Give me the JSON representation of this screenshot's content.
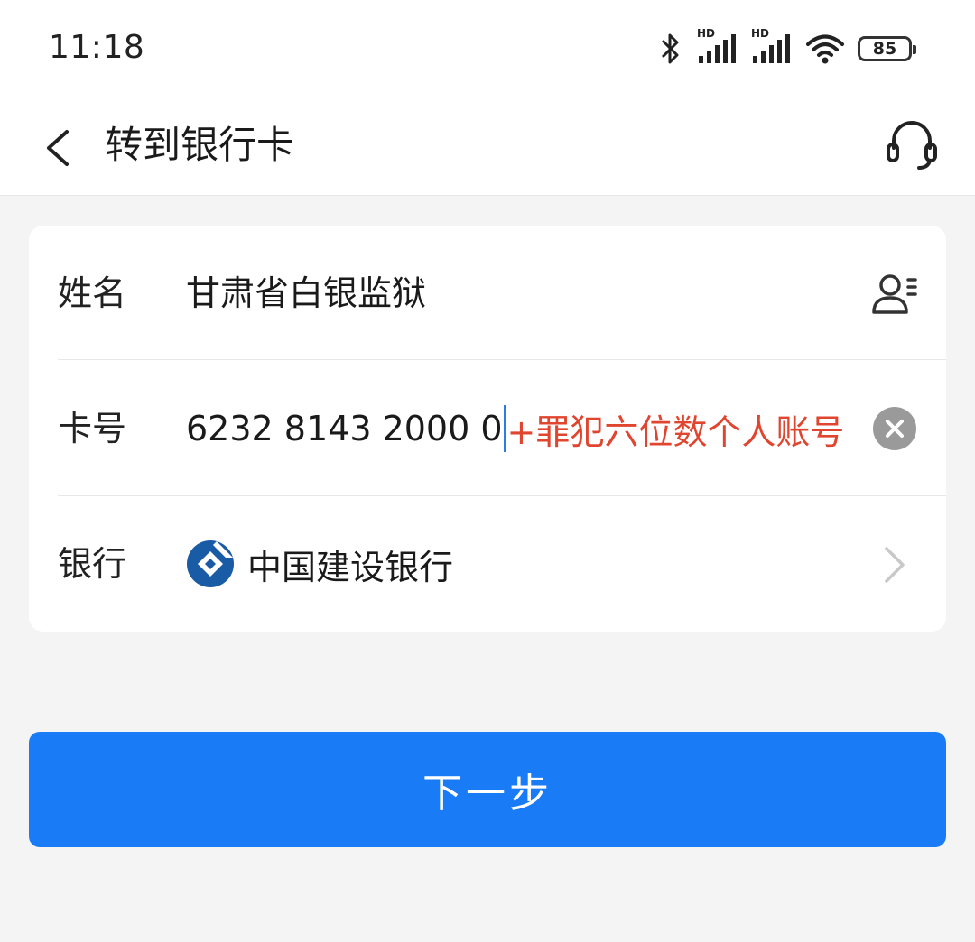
{
  "status_bar": {
    "time": "11:18",
    "battery_level": "85",
    "network_badge_1": "HD",
    "network_badge_2": "HD",
    "icons": [
      "bluetooth-icon",
      "signal-icon",
      "signal-icon",
      "wifi-icon",
      "battery-icon"
    ]
  },
  "header": {
    "title": "转到银行卡",
    "back_icon": "chevron-left-icon",
    "support_icon": "headset-icon"
  },
  "form": {
    "name": {
      "label": "姓名",
      "value": "甘肃省白银监狱",
      "icon": "contact-picker-icon"
    },
    "card_number": {
      "label": "卡号",
      "value": "6232 8143 2000 0",
      "annotation": "+罪犯六位数个人账号",
      "icon": "clear-icon"
    },
    "bank": {
      "label": "银行",
      "value": "中国建设银行",
      "logo": "ccb-logo",
      "icon": "chevron-right-icon"
    }
  },
  "actions": {
    "next_label": "下一步"
  },
  "colors": {
    "primary": "#1a7bf7",
    "annotation": "#e0452f",
    "caret": "#2d7be5",
    "bank_logo": "#1a5ba6",
    "background": "#f4f4f4"
  }
}
